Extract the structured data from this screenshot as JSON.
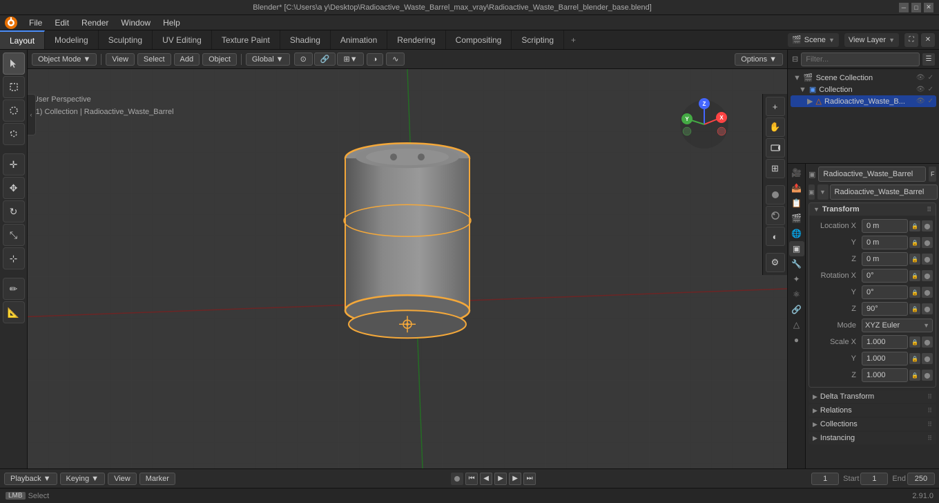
{
  "titlebar": {
    "title": "Blender* [C:\\Users\\a y\\Desktop\\Radioactive_Waste_Barrel_max_vray\\Radioactive_Waste_Barrel_blender_base.blend]"
  },
  "menu": {
    "items": [
      "Blender",
      "File",
      "Edit",
      "Render",
      "Window",
      "Help"
    ]
  },
  "workspace_tabs": {
    "tabs": [
      "Layout",
      "Modeling",
      "Sculpting",
      "UV Editing",
      "Texture Paint",
      "Shading",
      "Animation",
      "Rendering",
      "Compositing",
      "Scripting"
    ],
    "active": "Layout",
    "add_label": "+",
    "scene_label": "Scene",
    "view_layer_label": "View Layer"
  },
  "viewport_header": {
    "mode_label": "Object Mode",
    "view_label": "View",
    "select_label": "Select",
    "add_label": "Add",
    "object_label": "Object",
    "global_label": "Global",
    "options_label": "Options"
  },
  "viewport_info": {
    "line1": "User Perspective",
    "line2": "(1) Collection | Radioactive_Waste_Barrel"
  },
  "outliner": {
    "scene_collection": "Scene Collection",
    "collection": "Collection",
    "object": "Radioactive_Waste_B..."
  },
  "properties": {
    "object_name": "Radioactive_Waste_Barrel",
    "mesh_name": "Radioactive_Waste_Barrel",
    "transform": {
      "header": "Transform",
      "location_x": "0 m",
      "location_y": "0 m",
      "location_z": "0 m",
      "rotation_x": "0°",
      "rotation_y": "0°",
      "rotation_z": "90°",
      "mode_label": "Mode",
      "mode_value": "XYZ Euler",
      "scale_x": "1.000",
      "scale_y": "1.000",
      "scale_z": "1.000"
    },
    "delta_transform": {
      "header": "Delta Transform"
    },
    "relations": {
      "header": "Relations"
    },
    "collections": {
      "header": "Collections"
    },
    "instancing": {
      "header": "Instancing"
    }
  },
  "timeline": {
    "playback_label": "Playback",
    "keying_label": "Keying",
    "view_label": "View",
    "marker_label": "Marker",
    "frame_current": "1",
    "start_label": "Start",
    "start_value": "1",
    "end_label": "End",
    "end_value": "250"
  },
  "status_bar": {
    "select_key": "Select",
    "version": "2.91.0"
  },
  "icons": {
    "blender": "⬡",
    "cursor": "↖",
    "move": "✥",
    "rotate": "↻",
    "scale": "⤡",
    "transform": "⊹",
    "annotate": "✏",
    "measure": "📐",
    "zoom_in": "+",
    "hand": "✋",
    "camera": "🎥",
    "grid": "⊞",
    "scene_icon": "🎬",
    "scene_obj": "▣",
    "mesh_icon": "△",
    "lock": "🔒",
    "eye": "👁",
    "checkbox": "✓",
    "collapse": "▶",
    "expand": "▼",
    "arrow_down": "▼",
    "arrow_right": "▶"
  },
  "colors": {
    "accent_blue": "#1f4299",
    "orange_select": "#f4a83a",
    "tab_active_bg": "#3a3a3a",
    "sidebar_bg": "#2b2b2b",
    "panel_bg": "#262626",
    "input_bg": "#3a3a3a"
  }
}
